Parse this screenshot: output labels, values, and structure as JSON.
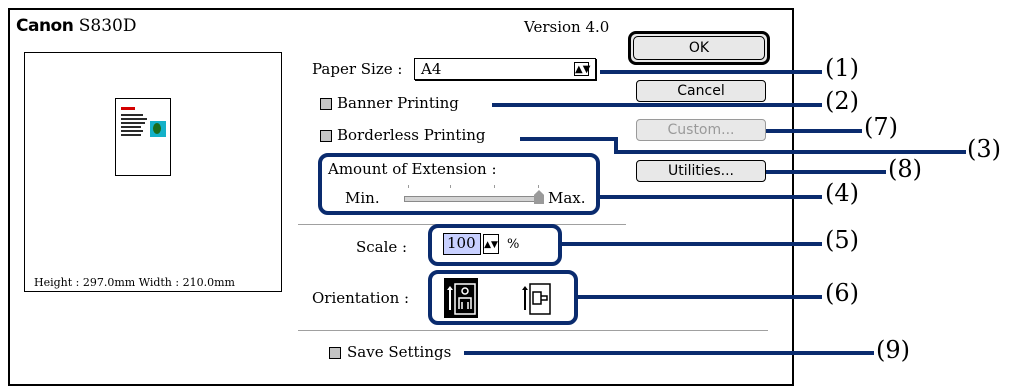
{
  "brand": {
    "logo": "Canon",
    "model": "S830D"
  },
  "version": "Version 4.0",
  "preview": {
    "page_logo": "Canon",
    "dimensions": "Height : 297.0mm    Width : 210.0mm"
  },
  "paper_size": {
    "label": "Paper Size :",
    "value": "A4"
  },
  "banner_printing": {
    "label": "Banner Printing",
    "checked": false
  },
  "borderless_printing": {
    "label": "Borderless Printing",
    "checked": false
  },
  "extension": {
    "label": "Amount of Extension :",
    "min": "Min.",
    "max": "Max.",
    "level": 1.0
  },
  "scale": {
    "label": "Scale :",
    "value": "100",
    "unit": "%"
  },
  "orientation": {
    "label": "Orientation :",
    "selected": "portrait",
    "options": [
      "portrait",
      "landscape"
    ]
  },
  "save_settings": {
    "label": "Save Settings",
    "checked": false
  },
  "buttons": {
    "ok": "OK",
    "cancel": "Cancel",
    "custom": "Custom...",
    "utilities": "Utilities..."
  },
  "callouts": [
    "(1)",
    "(2)",
    "(3)",
    "(4)",
    "(5)",
    "(6)",
    "(7)",
    "(8)",
    "(9)"
  ],
  "colors": {
    "callout": "#0a2b6e",
    "scale_field": "#c8d0ff",
    "leaf_bg": "#14b1c8"
  }
}
